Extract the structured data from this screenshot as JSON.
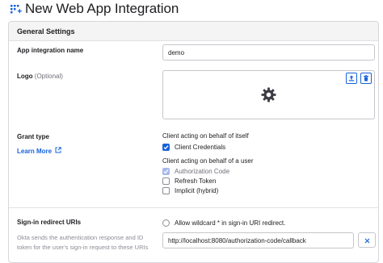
{
  "page": {
    "title": "New Web App Integration",
    "title_icon": "grid-plus-icon"
  },
  "panel": {
    "title": "General Settings"
  },
  "app_name": {
    "label": "App integration name",
    "value": "demo"
  },
  "logo": {
    "label": "Logo",
    "optional": "(Optional)",
    "upload_icon": "upload-icon",
    "delete_icon": "trash-icon",
    "placeholder_icon": "gear-icon"
  },
  "grant_type": {
    "label": "Grant type",
    "learn_more": "Learn More",
    "itself_heading": "Client acting on behalf of itself",
    "client_credentials": {
      "label": "Client Credentials",
      "checked": true
    },
    "user_heading": "Client acting on behalf of a user",
    "authorization_code": {
      "label": "Authorization Code",
      "checked": true,
      "disabled": true
    },
    "refresh_token": {
      "label": "Refresh Token",
      "checked": false
    },
    "implicit": {
      "label": "Implicit (hybrid)",
      "checked": false
    }
  },
  "redirect": {
    "label": "Sign-in redirect URIs",
    "wildcard": {
      "label": "Allow wildcard * in sign-in URI redirect.",
      "checked": false
    },
    "description": "Okta sends the authentication response and ID token for the user's sign-in request to these URIs",
    "uri_value": "http://localhost:8080/authorization-code/callback"
  },
  "colors": {
    "accent": "#1662dd",
    "border": "#c6c6cc",
    "header_bg": "#f4f4f4"
  }
}
